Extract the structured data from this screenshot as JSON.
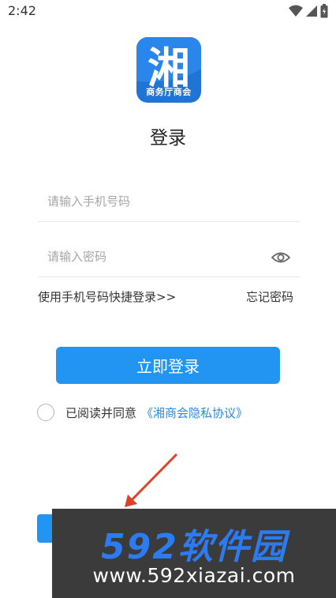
{
  "status_bar": {
    "time": "2:42",
    "icons": [
      "wifi-icon",
      "signal-icon",
      "battery-icon"
    ]
  },
  "logo": {
    "glyph": "湘",
    "caption": "商务厅商会",
    "colors": {
      "background": "#1f74d6",
      "glyph": "#ffffff"
    }
  },
  "page_title": "登录",
  "form": {
    "phone_placeholder": "请输入手机号码",
    "phone_value": "",
    "password_placeholder": "请输入密码",
    "password_value": "",
    "password_toggle_icon": "eye-icon"
  },
  "links": {
    "quick_login": "使用手机号码快捷登录>>",
    "forgot_password": "忘记密码"
  },
  "login_button_label": "立即登录",
  "agreement": {
    "text": "已阅读并同意",
    "link": "《湘商会隐私协议》",
    "checked": false
  },
  "watermark": {
    "brand": "592软件园",
    "url": "www.592xiazai.com"
  },
  "colors": {
    "primary": "#2294f2",
    "link": "#2b8ae0",
    "watermark_bg": "#3b3b3b",
    "watermark_brand": "#2d7bf0",
    "arrow": "#d8432a"
  }
}
